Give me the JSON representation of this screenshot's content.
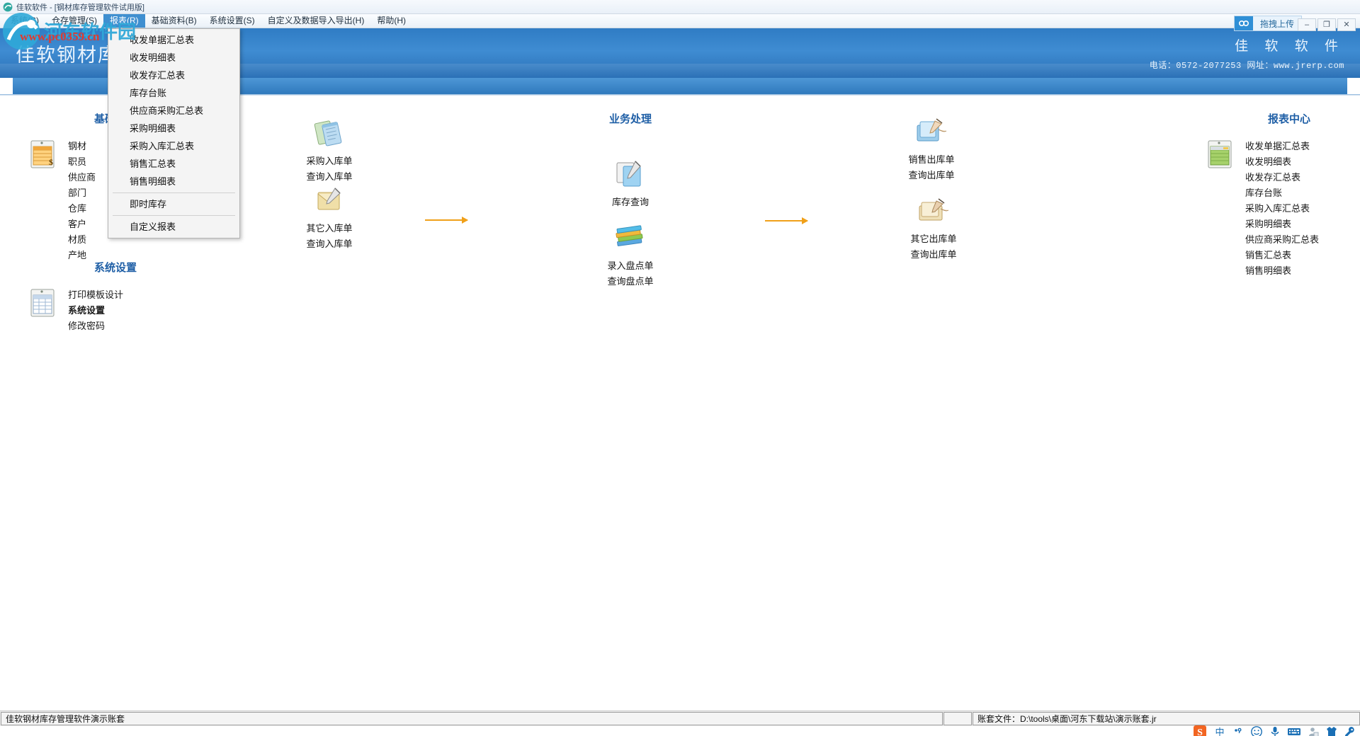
{
  "window": {
    "title": "佳软软件 - [钢材库存管理软件试用版]",
    "app_icon": "app-icon",
    "controls": {
      "minimize": "–",
      "maximize": "❐",
      "close": "✕"
    },
    "upload_chip": {
      "label": "拖拽上传",
      "icon": "cloud-link-icon"
    }
  },
  "menubar": {
    "items": [
      {
        "label": "系统(S)",
        "active": false
      },
      {
        "label": "仓存管理(S)",
        "active": false
      },
      {
        "label": "报表(R)",
        "active": true
      },
      {
        "label": "基础资料(B)",
        "active": false
      },
      {
        "label": "系统设置(S)",
        "active": false
      },
      {
        "label": "自定义及数据导入导出(H)",
        "active": false
      },
      {
        "label": "帮助(H)",
        "active": false
      }
    ]
  },
  "banner": {
    "title": "佳软钢材库存管理软件",
    "brand_name": "佳 软 软 件",
    "contact": "电话：0572-2077253  网址：www.jrerp.com"
  },
  "dropdown": {
    "name": "报表菜单",
    "items": [
      {
        "label": "收发单据汇总表",
        "separator_after": false
      },
      {
        "label": "收发明细表",
        "separator_after": false
      },
      {
        "label": "收发存汇总表",
        "separator_after": false
      },
      {
        "label": "库存台账",
        "separator_after": false
      },
      {
        "label": "供应商采购汇总表",
        "separator_after": false
      },
      {
        "label": "采购明细表",
        "separator_after": false
      },
      {
        "label": "采购入库汇总表",
        "separator_after": false
      },
      {
        "label": "销售汇总表",
        "separator_after": false
      },
      {
        "label": "销售明细表",
        "separator_after": true
      },
      {
        "label": "即时库存",
        "separator_after": true
      },
      {
        "label": "自定义报表",
        "separator_after": false
      }
    ]
  },
  "columns": {
    "basic": {
      "title": "基础资料",
      "icon": "basic-data-icon",
      "links": [
        "钢材",
        "职员",
        "供应商",
        "部门",
        "仓库",
        "客户",
        "材质",
        "产地"
      ]
    },
    "settings": {
      "title": "系统设置",
      "icon": "system-settings-icon",
      "links": [
        {
          "label": "打印模板设计",
          "bold": false
        },
        {
          "label": "系统设置",
          "bold": true
        },
        {
          "label": "修改密码",
          "bold": false
        }
      ]
    },
    "inbound": [
      {
        "icon": "purchase-in-icon",
        "labels": [
          "采购入库单",
          "查询入库单"
        ]
      },
      {
        "icon": "other-in-icon",
        "labels": [
          "其它入库单",
          "查询入库单"
        ]
      }
    ],
    "business": {
      "title": "业务处理",
      "items": [
        {
          "icon": "stock-query-icon",
          "labels": [
            "库存查询"
          ]
        },
        {
          "icon": "stocktake-icon",
          "labels": [
            "录入盘点单",
            "查询盘点单"
          ]
        }
      ]
    },
    "outbound": [
      {
        "icon": "sales-out-icon",
        "labels": [
          "销售出库单",
          "查询出库单"
        ]
      },
      {
        "icon": "other-out-icon",
        "labels": [
          "其它出库单",
          "查询出库单"
        ]
      }
    ],
    "reports": {
      "title": "报表中心",
      "icon": "report-center-icon",
      "links": [
        "收发单据汇总表",
        "收发明细表",
        "收发存汇总表",
        "库存台账",
        "采购入库汇总表",
        "采购明细表",
        "供应商采购汇总表",
        "销售汇总表",
        "销售明细表"
      ]
    }
  },
  "statusbar": {
    "left": "佳软钢材库存管理软件演示账套",
    "middle": "",
    "right": "账套文件：D:\\tools\\桌面\\河东下载站\\演示账套.jr"
  },
  "tray": {
    "icons": [
      "sogou-icon",
      "chinese-input-icon",
      "punctuation-icon",
      "emoji-icon",
      "microphone-icon",
      "keyboard-icon",
      "user-icon",
      "skin-icon",
      "tools-icon"
    ]
  },
  "watermark": {
    "line1": "www.pc0359.cn",
    "line2": "河东软件园"
  },
  "colors": {
    "banner_blue": "#3f8cd2",
    "heading_blue": "#1f5fa6",
    "menu_active": "#3f8fd0",
    "arrow_orange": "#f0a019"
  }
}
